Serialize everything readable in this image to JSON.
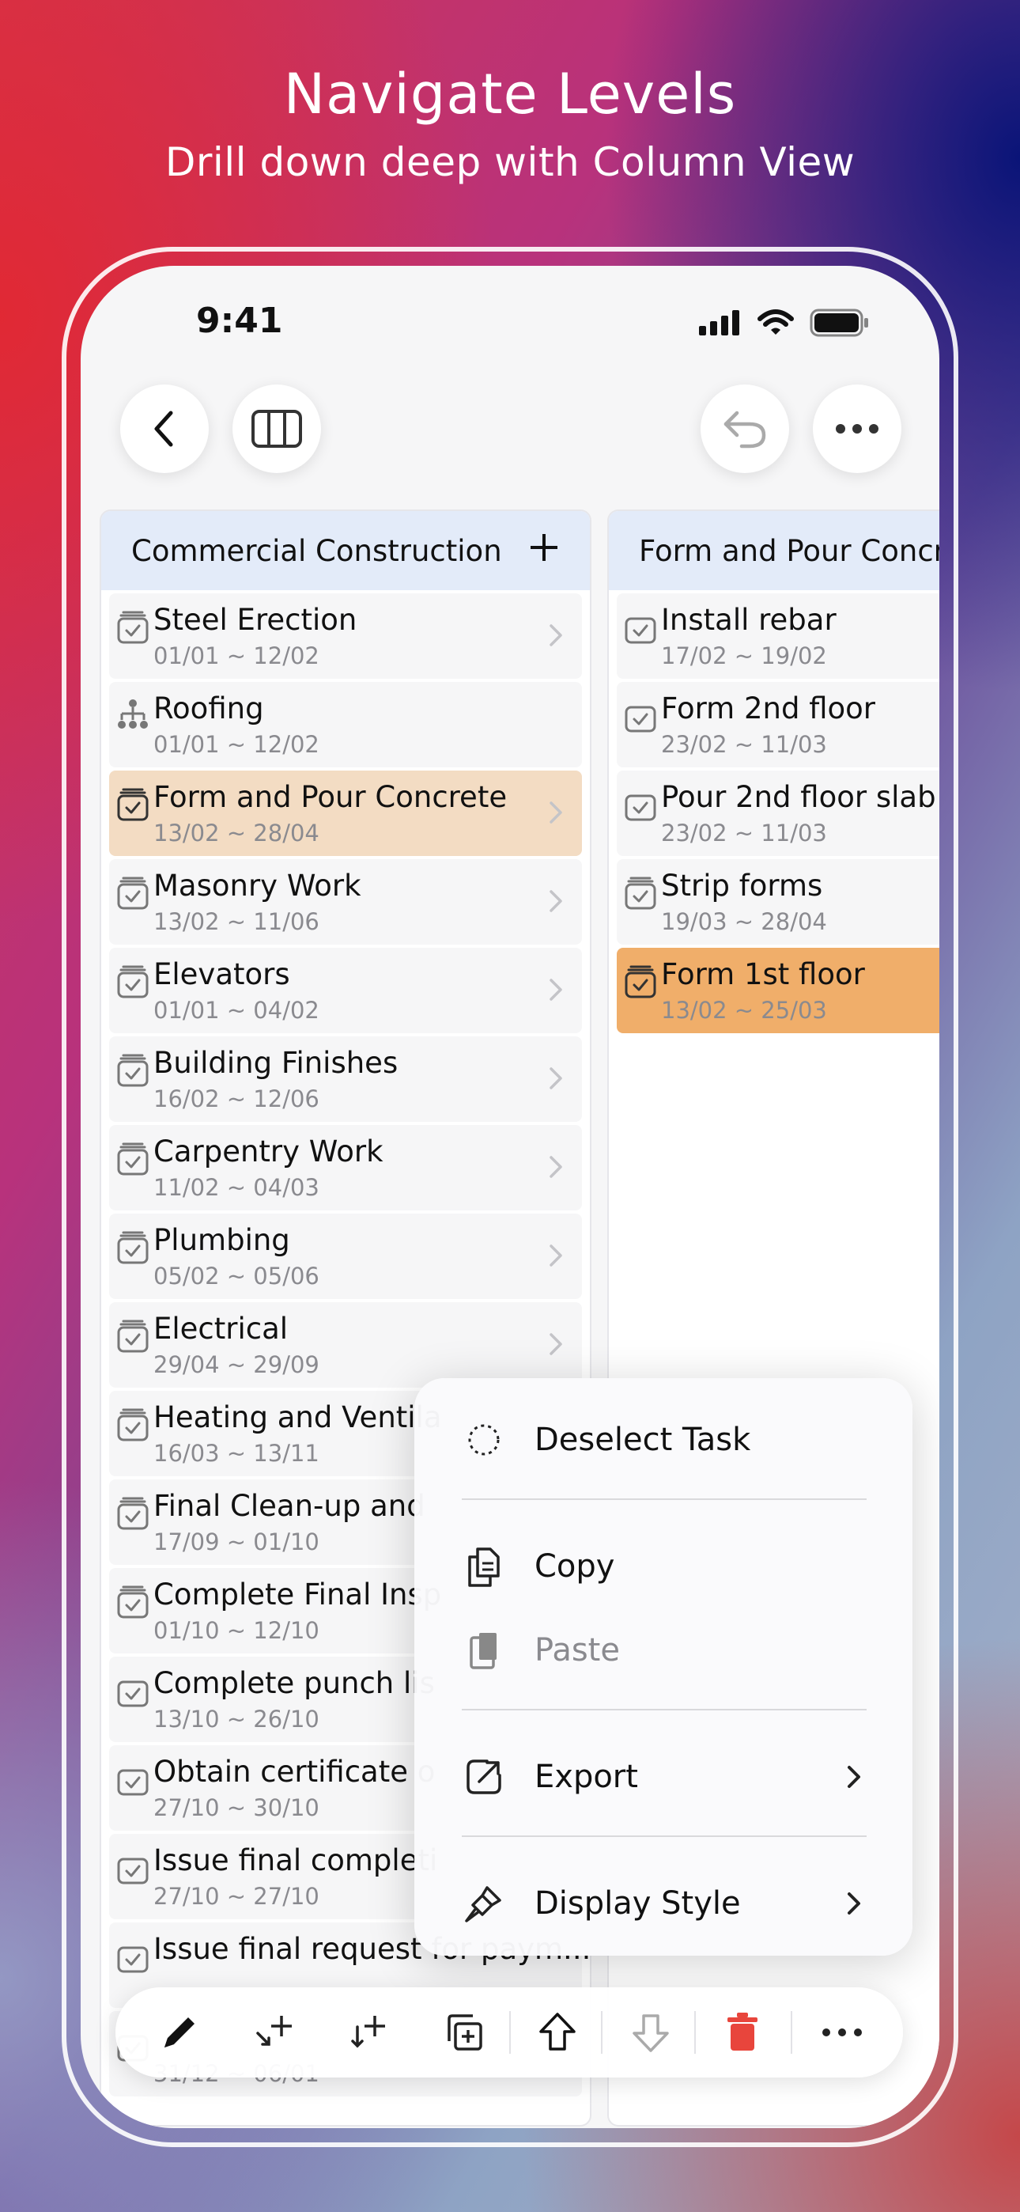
{
  "header": {
    "title": "Navigate Levels",
    "subtitle": "Drill down deep with Column View"
  },
  "status_bar": {
    "time": "9:41"
  },
  "nav": {
    "back_icon": "chevron-left-icon",
    "column_view_icon": "columns-icon",
    "undo_icon": "undo-icon",
    "more_icon": "ellipsis-icon"
  },
  "columns": [
    {
      "title": "Commercial Construction",
      "add_label": "+",
      "rows": [
        {
          "title": "Steel Erection",
          "date": "01/01 ~ 12/02",
          "icon": "task-stack-icon",
          "chevron": true
        },
        {
          "title": "Roofing",
          "date": "01/01 ~ 12/02",
          "icon": "hierarchy-icon",
          "chevron": false
        },
        {
          "title": "Form and Pour Concrete",
          "date": "13/02 ~ 28/04",
          "icon": "task-stack-icon",
          "chevron": true,
          "selected": true
        },
        {
          "title": "Masonry Work",
          "date": "13/02 ~ 11/06",
          "icon": "task-stack-icon",
          "chevron": true
        },
        {
          "title": "Elevators",
          "date": "01/01 ~ 04/02",
          "icon": "task-stack-icon",
          "chevron": true
        },
        {
          "title": "Building Finishes",
          "date": "16/02 ~ 12/06",
          "icon": "task-stack-icon",
          "chevron": true
        },
        {
          "title": "Carpentry Work",
          "date": "11/02 ~ 04/03",
          "icon": "task-stack-icon",
          "chevron": true
        },
        {
          "title": "Plumbing",
          "date": "05/02 ~ 05/06",
          "icon": "task-stack-icon",
          "chevron": true
        },
        {
          "title": "Electrical",
          "date": "29/04 ~ 29/09",
          "icon": "task-stack-icon",
          "chevron": true
        },
        {
          "title": "Heating and Ventila",
          "date": "16/03 ~ 13/11",
          "icon": "task-stack-icon",
          "chevron": false
        },
        {
          "title": "Final Clean-up and",
          "date": "17/09 ~ 01/10",
          "icon": "task-stack-icon",
          "chevron": false
        },
        {
          "title": "Complete Final Insp",
          "date": "01/10 ~ 12/10",
          "icon": "task-stack-icon",
          "chevron": false
        },
        {
          "title": "Complete punch lis",
          "date": "13/10 ~ 26/10",
          "icon": "checkbox-icon",
          "chevron": false
        },
        {
          "title": "Obtain certificate o",
          "date": "27/10 ~ 30/10",
          "icon": "checkbox-icon",
          "chevron": false
        },
        {
          "title": "Issue final completi",
          "date": "27/10 ~ 27/10",
          "icon": "checkbox-icon",
          "chevron": false
        },
        {
          "title": "Issue final request for paym...",
          "date": "",
          "icon": "checkbox-icon",
          "chevron": false
        },
        {
          "title": "",
          "date": "31/12 ~ 06/01",
          "icon": "checkbox-icon",
          "chevron": false
        }
      ]
    },
    {
      "title": "Form and Pour Concrete",
      "rows": [
        {
          "title": "Install rebar",
          "date": "17/02 ~ 19/02",
          "icon": "checkbox-icon"
        },
        {
          "title": "Form 2nd floor",
          "date": "23/02 ~ 11/03",
          "icon": "checkbox-icon"
        },
        {
          "title": "Pour 2nd floor slab",
          "date": "23/02 ~ 11/03",
          "icon": "checkbox-icon"
        },
        {
          "title": "Strip forms",
          "date": "19/03 ~ 28/04",
          "icon": "task-stack-icon"
        },
        {
          "title": "Form 1st floor",
          "date": "13/02 ~ 25/03",
          "icon": "task-stack-icon",
          "selected": true
        }
      ]
    }
  ],
  "context_menu": {
    "items": [
      {
        "label": "Deselect Task",
        "icon": "dashed-circle-icon",
        "chevron": false,
        "disabled": false
      },
      {
        "label": "Copy",
        "icon": "copy-icon",
        "chevron": false,
        "disabled": false
      },
      {
        "label": "Paste",
        "icon": "paste-icon",
        "chevron": false,
        "disabled": true
      },
      {
        "label": "Export",
        "icon": "export-icon",
        "chevron": true,
        "disabled": false
      },
      {
        "label": "Display Style",
        "icon": "brush-icon",
        "chevron": true,
        "disabled": false
      }
    ]
  },
  "toolbar": {
    "items": [
      "pencil-icon",
      "add-sibling-icon",
      "add-child-icon",
      "duplicate-icon",
      "move-up-icon",
      "move-down-icon",
      "trash-icon",
      "ellipsis-icon"
    ]
  },
  "colors": {
    "column_header": "#e3ebf9",
    "selected_parent": "#f3dcc3",
    "selected_child": "#f0ae6a",
    "delete": "#e8453c"
  }
}
